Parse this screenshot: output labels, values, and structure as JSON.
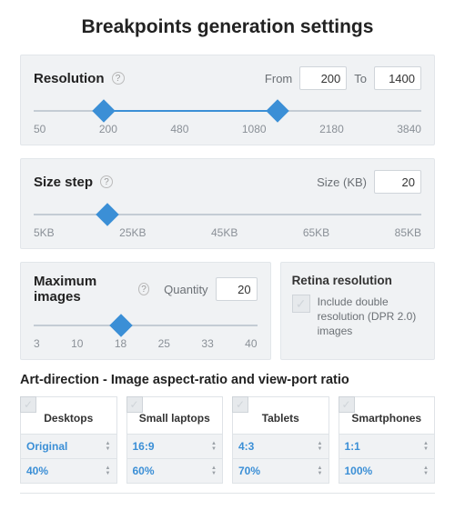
{
  "title": "Breakpoints generation settings",
  "resolution": {
    "label": "Resolution",
    "from_label": "From",
    "from_value": "200",
    "to_label": "To",
    "to_value": "1400",
    "ticks": [
      "50",
      "200",
      "480",
      "1080",
      "2180",
      "3840"
    ],
    "active_left_pct": 18,
    "active_right_pct": 63
  },
  "size_step": {
    "label": "Size step",
    "size_label": "Size (KB)",
    "value": "20",
    "ticks": [
      "5KB",
      "25KB",
      "45KB",
      "65KB",
      "85KB"
    ],
    "handle_pct": 19
  },
  "max_images": {
    "label": "Maximum images",
    "qty_label": "Quantity",
    "value": "20",
    "ticks": [
      "3",
      "10",
      "18",
      "25",
      "33",
      "40"
    ],
    "handle_pct": 39
  },
  "retina": {
    "title": "Retina resolution",
    "desc": "Include double resolution (DPR 2.0) images"
  },
  "art": {
    "title": "Art-direction - Image aspect-ratio and view-port ratio",
    "cards": [
      {
        "device": "Desktops",
        "ratio": "Original",
        "vp": "40%"
      },
      {
        "device": "Small laptops",
        "ratio": "16:9",
        "vp": "60%"
      },
      {
        "device": "Tablets",
        "ratio": "4:3",
        "vp": "70%"
      },
      {
        "device": "Smartphones",
        "ratio": "1:1",
        "vp": "100%"
      }
    ]
  }
}
